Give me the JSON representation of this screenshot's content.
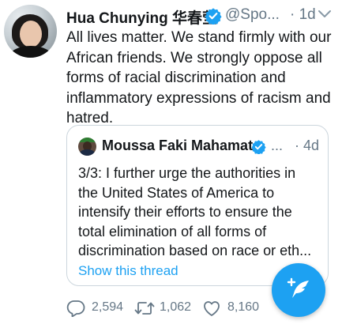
{
  "tweet": {
    "author_name": "Hua Chunying 华春莹",
    "handle": "@Spo...",
    "time": "· 1d",
    "text": "All lives matter. We stand firmly with our\nAfrican friends. We strongly oppose all\nforms of racial discrimination and\ninflammatory expressions of racism and\nhatred."
  },
  "quoted_tweet": {
    "author_name": "Moussa Faki Mahamat",
    "handle": "...",
    "time": "· 4d",
    "text": "3/3: I further urge the authorities in\nthe United States of America to\nintensify their efforts to ensure the\ntotal elimination of all forms of\ndiscrimination based on race or eth...",
    "show_thread": "Show this thread"
  },
  "actions": {
    "replies": "2,594",
    "retweets": "1,062",
    "likes": "8,160"
  },
  "icons": {
    "verified": "verified-badge-icon",
    "caret": "chevron-down-icon",
    "reply": "reply-icon",
    "retweet": "retweet-icon",
    "like": "heart-icon",
    "share": "share-icon",
    "compose": "compose-tweet-icon"
  },
  "colors": {
    "accent": "#1da1f2",
    "text": "#14171a",
    "muted": "#657786",
    "border": "#ccd6dd"
  }
}
